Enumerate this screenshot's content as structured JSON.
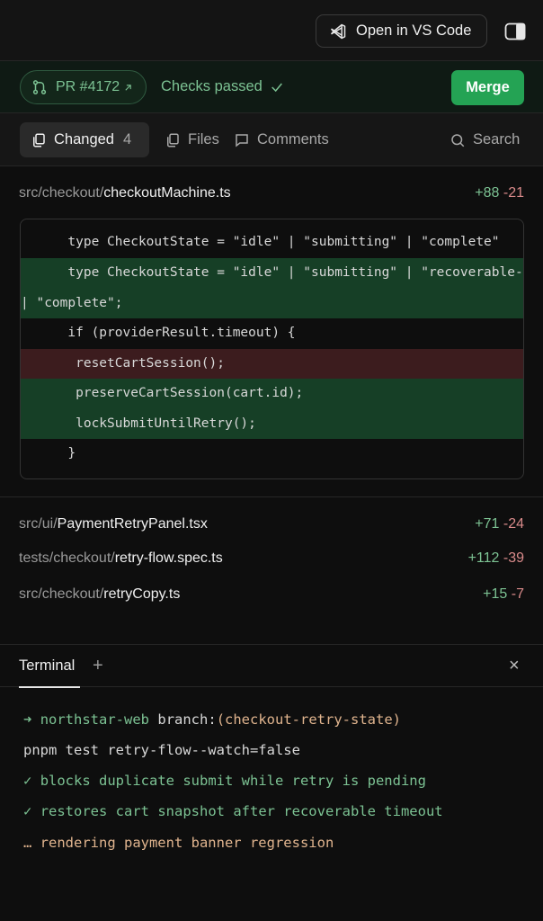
{
  "toolbar": {
    "open_vscode_label": "Open in VS Code"
  },
  "pr": {
    "label": "PR #4172",
    "checks_label": "Checks passed",
    "merge_label": "Merge"
  },
  "tabs": {
    "changed_label": "Changed",
    "changed_count": "4",
    "files_label": "Files",
    "comments_label": "Comments",
    "search_label": "Search"
  },
  "files": [
    {
      "dir": "src/checkout/",
      "name": "checkoutMachine.ts",
      "add": "+88",
      "del": "-21"
    },
    {
      "dir": "src/ui/",
      "name": "PaymentRetryPanel.tsx",
      "add": "+71",
      "del": "-24"
    },
    {
      "dir": "tests/checkout/",
      "name": "retry-flow.spec.ts",
      "add": "+112",
      "del": "-39"
    },
    {
      "dir": "src/checkout/",
      "name": "retryCopy.ts",
      "add": "+15",
      "del": "-7"
    }
  ],
  "diff": [
    {
      "kind": "ctx",
      "text": "      type CheckoutState = \"idle\" | \"submitting\" | \"complete\""
    },
    {
      "kind": "add",
      "text": "      type CheckoutState = \"idle\" | \"submitting\" | \"recoverable-error\""
    },
    {
      "kind": "add",
      "text": "| \"complete\";"
    },
    {
      "kind": "ctx",
      "text": "      if (providerResult.timeout) {"
    },
    {
      "kind": "rm",
      "text": "       resetCartSession();"
    },
    {
      "kind": "add",
      "text": "       preserveCartSession(cart.id);"
    },
    {
      "kind": "add",
      "text": "       lockSubmitUntilRetry();"
    },
    {
      "kind": "ctx",
      "text": "      }"
    }
  ],
  "terminal": {
    "tab_label": "Terminal",
    "prompt_arrow": "➜",
    "prompt_dir": "northstar-web",
    "prompt_branch_label": "branch:",
    "prompt_branch": "(checkout-retry-state)",
    "command": "pnpm test retry-flow--watch=false",
    "check_mark": "✓",
    "pass1": "blocks duplicate submit while retry is pending",
    "pass2": "restores cart snapshot after recoverable timeout",
    "pending": "… rendering payment banner regression"
  }
}
